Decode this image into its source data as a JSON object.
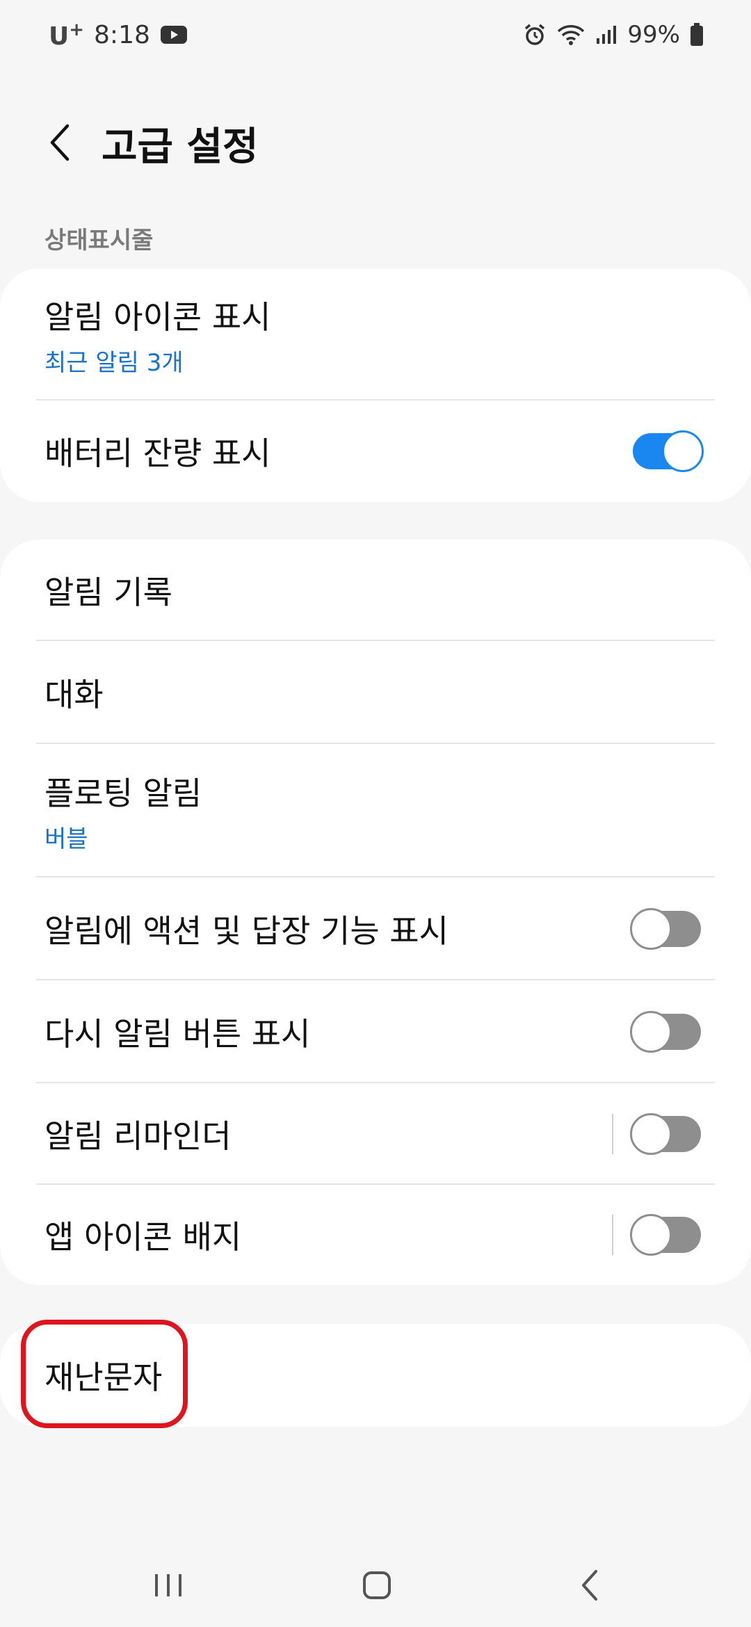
{
  "status_bar": {
    "carrier": "U",
    "carrier_plus": "+",
    "time": "8:18",
    "battery": "99%",
    "icons": [
      "youtube-icon",
      "alarm-icon",
      "wifi-icon",
      "signal-icon",
      "battery-icon"
    ]
  },
  "header": {
    "title": "고급 설정",
    "back_icon": "chevron-left-icon"
  },
  "sections": {
    "status_bar_label": "상태표시줄"
  },
  "card1": {
    "items": [
      {
        "title": "알림 아이콘 표시",
        "subtitle": "최근 알림 3개"
      },
      {
        "title": "배터리 잔량 표시",
        "toggle": true
      }
    ]
  },
  "card2": {
    "items": [
      {
        "title": "알림 기록"
      },
      {
        "title": "대화"
      },
      {
        "title": "플로팅 알림",
        "subtitle": "버블"
      },
      {
        "title": "알림에 액션 및 답장 기능 표시",
        "toggle": false
      },
      {
        "title": "다시 알림 버튼 표시",
        "toggle": false
      },
      {
        "title": "알림 리마인더",
        "toggle": false
      },
      {
        "title": "앱 아이콘 배지",
        "toggle": false
      }
    ]
  },
  "card3": {
    "items": [
      {
        "title": "재난문자"
      }
    ]
  },
  "nav_bar": {
    "icons": [
      "recents-icon",
      "home-icon",
      "back-icon"
    ]
  },
  "colors": {
    "accent": "#1a87f0",
    "subtitle": "#1a73c8",
    "highlight": "#e0141e",
    "background": "#f6f6f6"
  }
}
